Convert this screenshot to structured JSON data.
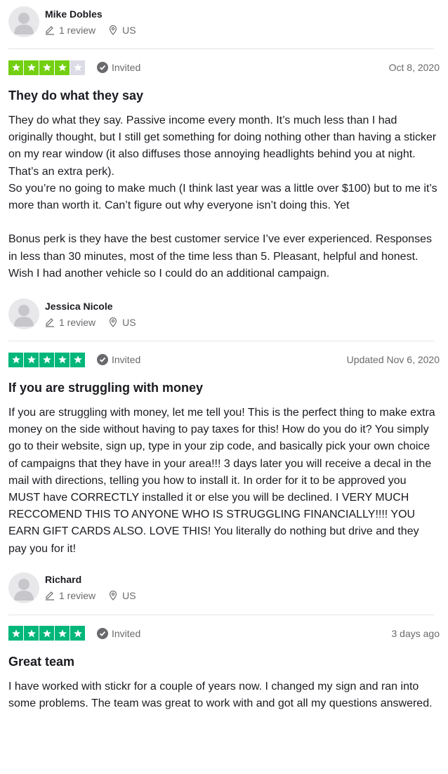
{
  "reviews": [
    {
      "name": "Mike Dobles",
      "review_count": "1 review",
      "country": "US",
      "stars": 4,
      "invited": "Invited",
      "date": "Oct 8, 2020",
      "title": "They do what they say",
      "body": "They do what they say. Passive income every month. It’s much less than I had originally thought, but I still get something for doing nothing other than having a sticker on my rear window (it also diffuses those annoying headlights behind you at night. That’s an extra perk).\nSo you’re no going to make much (I think last year was a little over $100) but to me it’s more than worth it. Can’t figure out why everyone isn’t doing this. Yet\n\nBonus perk is they have the best customer service I’ve ever experienced. Responses in less than 30 minutes, most of the time less than 5. Pleasant, helpful and honest. Wish I had another vehicle so I could do an additional campaign."
    },
    {
      "name": "Jessica Nicole",
      "review_count": "1 review",
      "country": "US",
      "stars": 5,
      "invited": "Invited",
      "date": "Updated Nov 6, 2020",
      "title": "If you are struggling with money",
      "body": "If you are struggling with money, let me tell you! This is the perfect thing to make extra money on the side without having to pay taxes for this! How do you do it? You simply go to their website, sign up, type in your zip code, and basically pick your own choice of campaigns that they have in your area!!! 3 days later you will receive a decal in the mail with directions, telling you how to install it. In order for it to be approved you MUST have CORRECTLY installed it or else you will be declined. I VERY MUCH RECCOMEND THIS TO ANYONE WHO IS STRUGGLING FINANCIALLY!!!! YOU EARN GIFT CARDS ALSO. LOVE THIS! You literally do nothing but drive and they pay you for it!"
    },
    {
      "name": "Richard",
      "review_count": "1 review",
      "country": "US",
      "stars": 5,
      "invited": "Invited",
      "date": "3 days ago",
      "title": "Great team",
      "body": "I have worked with stickr for a couple of years now. I changed my sign and ran into some problems. The team was great to work with and got all my questions answered."
    }
  ],
  "colors": {
    "star_4": "#73cf11",
    "star_5": "#00b67a",
    "star_empty": "#dcdce6",
    "muted_text": "#6a6a6e"
  },
  "icons": {
    "avatar": "avatar-placeholder-icon",
    "review_count": "pencil-icon",
    "country": "location-pin-icon",
    "invited": "checkmark-circle-icon",
    "star": "star-icon"
  }
}
